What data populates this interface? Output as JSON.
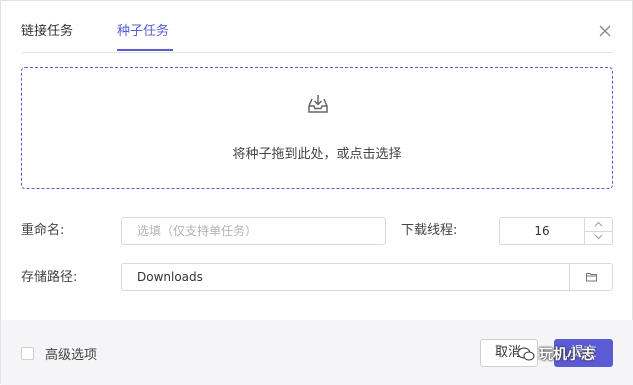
{
  "tabs": [
    {
      "label": "链接任务",
      "active": false
    },
    {
      "label": "种子任务",
      "active": true
    }
  ],
  "dropzone": {
    "text": "将种子拖到此处，或点击选择",
    "icon": "inbox-download-icon"
  },
  "form": {
    "rename_label": "重命名:",
    "rename_placeholder": "选填（仅支持单任务）",
    "threads_label": "下载线程:",
    "threads_value": "16",
    "path_label": "存储路径:",
    "path_value": "Downloads"
  },
  "footer": {
    "advanced_label": "高级选项",
    "cancel_label": "取消",
    "submit_label": "提交",
    "watermark": "玩机小志"
  },
  "colors": {
    "accent": "#5b5bd6",
    "border": "#d9d9d9",
    "footer_bg": "#f5f5f7"
  }
}
